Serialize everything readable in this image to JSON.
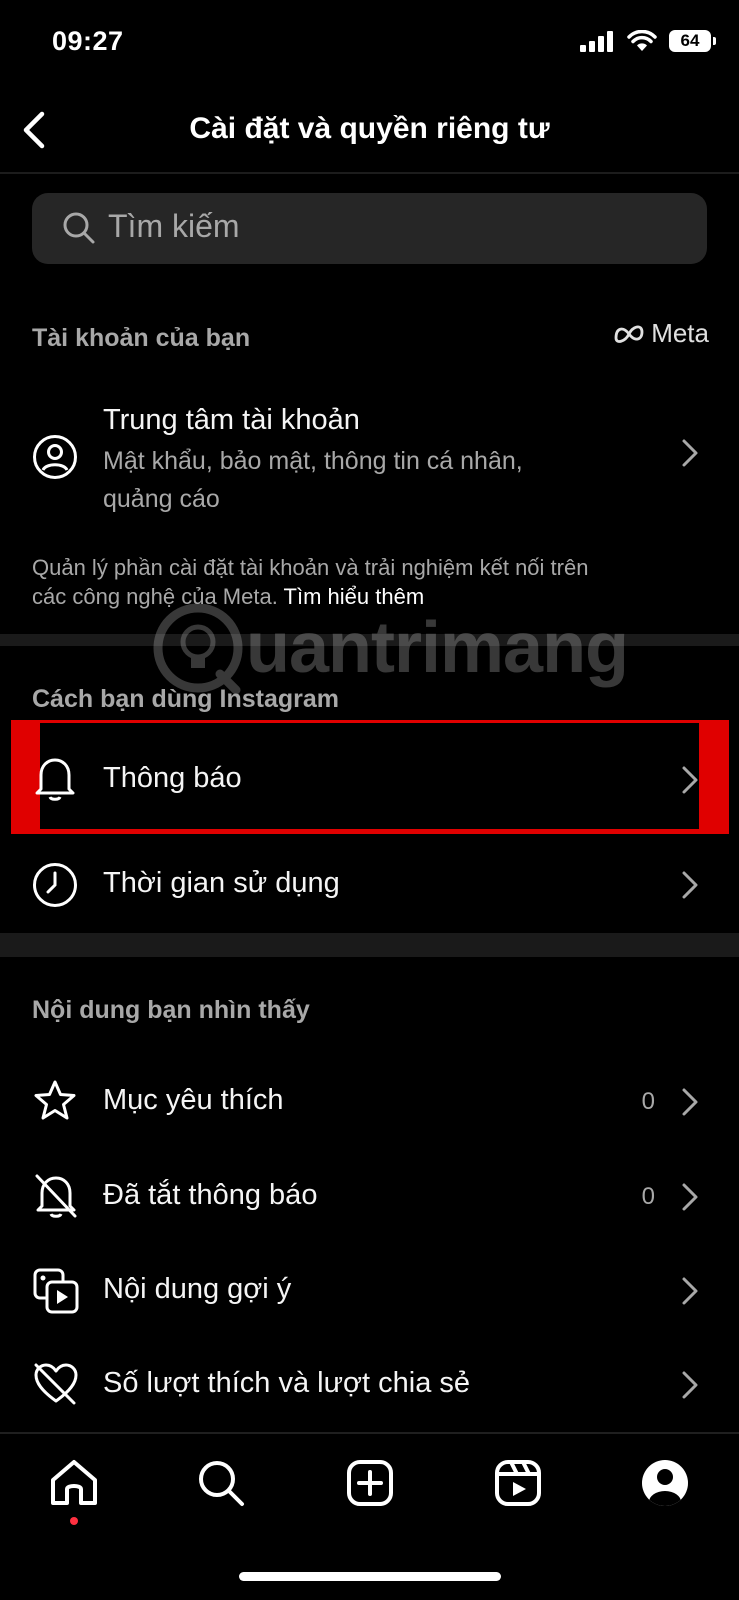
{
  "status": {
    "time": "09:27",
    "battery": "64"
  },
  "header": {
    "title": "Cài đặt và quyền riêng tư"
  },
  "search": {
    "placeholder": "Tìm kiếm"
  },
  "account_section": {
    "label": "Tài khoản của bạn",
    "meta_logo": "Meta",
    "account_center": {
      "title": "Trung tâm tài khoản",
      "subtitle_line1": "Mật khẩu, bảo mật, thông tin cá nhân,",
      "subtitle_line2": "quảng cáo"
    },
    "note_line1": "Quản lý phần cài đặt tài khoản và trải nghiệm kết nối trên",
    "note_line2": "các công nghệ của Meta.",
    "note_link": "Tìm hiểu thêm"
  },
  "usage_section": {
    "label": "Cách bạn dùng Instagram",
    "items": [
      {
        "label": "Thông báo",
        "icon": "bell-icon"
      },
      {
        "label": "Thời gian sử dụng",
        "icon": "clock-icon"
      }
    ]
  },
  "content_section": {
    "label": "Nội dung bạn nhìn thấy",
    "items": [
      {
        "label": "Mục yêu thích",
        "count": "0",
        "icon": "star-icon"
      },
      {
        "label": "Đã tắt thông báo",
        "count": "0",
        "icon": "bell-off-icon"
      },
      {
        "label": "Nội dung gợi ý",
        "icon": "suggested-content-icon"
      },
      {
        "label": "Số lượt thích và lượt chia sẻ",
        "icon": "heart-off-icon"
      }
    ]
  },
  "watermark": "uantrimang",
  "nav": [
    "home-icon",
    "search-icon",
    "create-icon",
    "reels-icon",
    "profile-icon"
  ],
  "colors": {
    "background": "#000000",
    "highlight_box": "#e00000",
    "notification_dot": "#ff3040"
  }
}
